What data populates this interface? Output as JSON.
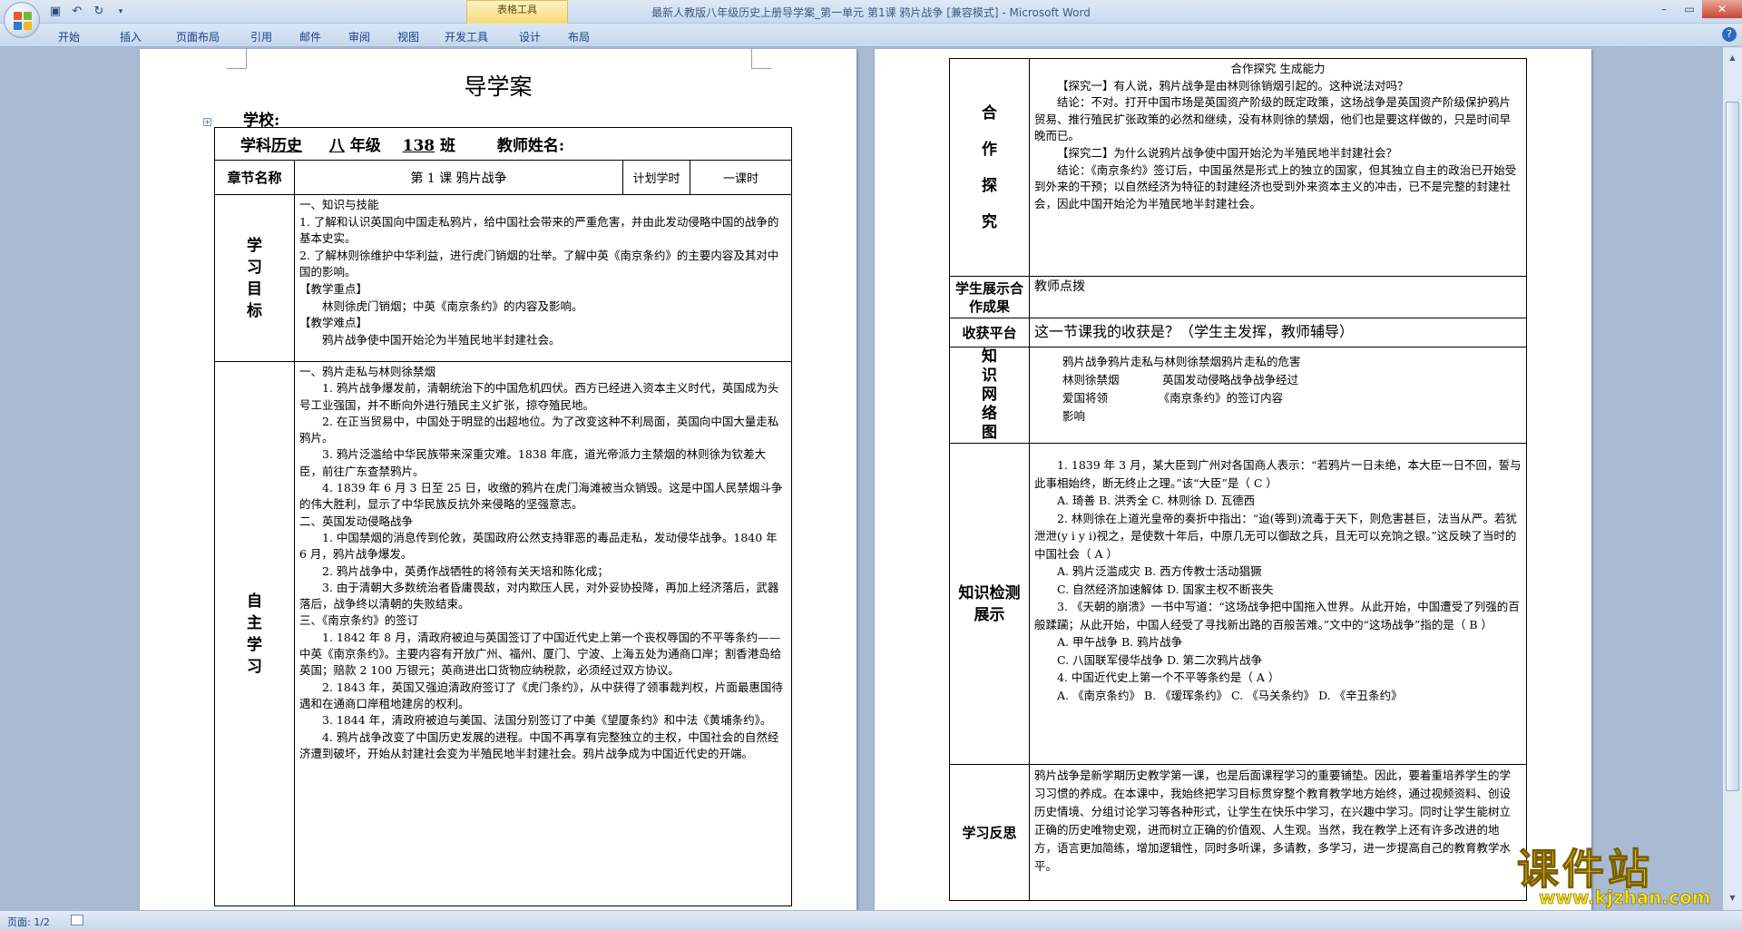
{
  "window": {
    "title": "最新人教版八年级历史上册导学案_第一单元 第1课   鸦片战争 [兼容模式] - Microsoft Word",
    "context_tab": "表格工具"
  },
  "ribbon": {
    "tabs": [
      "开始",
      "插入",
      "页面布局",
      "引用",
      "邮件",
      "审阅",
      "视图",
      "开发工具",
      "设计",
      "布局"
    ]
  },
  "status": {
    "page": "页面: 1/2"
  },
  "page1": {
    "title": "导学案",
    "school": "学校:",
    "header_row": {
      "subject_prefix": "学科",
      "subject": "历史",
      "grade": "八",
      "grade_suffix": "年级",
      "class_no": "138",
      "class_suffix": "班",
      "teacher": "教师姓名:"
    },
    "chapter": {
      "label": "章节名称",
      "title": "第 1 课   鸦片战争",
      "plan_label": "计划学时",
      "plan_value": "一课时"
    },
    "goals": {
      "label": "学习目标",
      "lines": [
        "一、知识与技能",
        "1. 了解和认识英国向中国走私鸦片，给中国社会带来的严重危害，并由此发动侵略中国的战争的基本史实。",
        "2. 了解林则徐维护中华利益，进行虎门销烟的壮举。了解中英《南京条约》的主要内容及其对中国的影响。",
        "【教学重点】",
        "林则徐虎门销烟；中英《南京条约》的内容及影响。",
        "【教学难点】",
        "鸦片战争使中国开始沦为半殖民地半封建社会。"
      ]
    },
    "self_study": {
      "label": "自主学习",
      "lines": [
        "一、鸦片走私与林则徐禁烟",
        "1. 鸦片战争爆发前，清朝统治下的中国危机四伏。西方已经进入资本主义时代，英国成为头号工业强国，并不断向外进行殖民主义扩张，掠夺殖民地。",
        "2. 在正当贸易中，中国处于明显的出超地位。为了改变这种不利局面，英国向中国大量走私鸦片。",
        "3. 鸦片泛滥给中华民族带来深重灾难。1838 年底，道光帝派力主禁烟的林则徐为钦差大臣，前往广东查禁鸦片。",
        "4. 1839 年 6 月 3 日至 25 日，收缴的鸦片在虎门海滩被当众销毁。这是中国人民禁烟斗争的伟大胜利，显示了中华民族反抗外来侵略的坚强意志。",
        "二、英国发动侵略战争",
        "1. 中国禁烟的消息传到伦敦，英国政府公然支持罪恶的毒品走私，发动侵华战争。1840 年 6 月，鸦片战争爆发。",
        "2. 鸦片战争中，英勇作战牺牲的将领有关天培和陈化成；",
        "3. 由于清朝大多数统治者昏庸畏敌，对内欺压人民，对外妥协投降，再加上经济落后，武器落后，战争终以清朝的失败结束。",
        "三、《南京条约》的签订",
        "1. 1842 年 8 月，清政府被迫与英国签订了中国近代史上第一个丧权辱国的不平等条约——中英《南京条约》。主要内容有开放广州、福州、厦门、宁波、上海五处为通商口岸；割香港岛给英国；赔款 2   100 万银元；英商进出口货物应纳税款，必须经过双方协议。",
        "2. 1843 年，英国又强迫清政府签订了《虎门条约》，从中获得了领事裁判权，片面最惠国待遇和在通商口岸租地建房的权利。",
        "3. 1844 年，清政府被迫与美国、法国分别签订了中美《望厦条约》和中法《黄埔条约》。",
        "4. 鸦片战争改变了中国历史发展的进程。中国不再享有完整独立的主权，中国社会的自然经济遭到破坏，开始从封建社会变为半殖民地半封建社会。鸦片战争成为中国近代史的开端。"
      ]
    }
  },
  "page2": {
    "explore": {
      "label": "合作探究",
      "lines": [
        "合作探究   生成能力",
        "【探究一】有人说，鸦片战争是由林则徐销烟引起的。这种说法对吗？",
        "结论：不对。打开中国市场是英国资产阶级的既定政策，这场战争是英国资产阶级保护鸦片贸易、推行殖民扩张政策的必然和继续，没有林则徐的禁烟，他们也是要这样做的，只是时间早晚而已。",
        "【探究二】为什么说鸦片战争使中国开始沦为半殖民地半封建社会？",
        "结论：《南京条约》签订后，中国虽然是形式上的独立的国家，但其独立自主的政治已开始受到外来的干预；以自然经济为特征的封建经济也受到外来资本主义的冲击，已不是完整的封建社会，因此中国开始沦为半殖民地半封建社会。"
      ]
    },
    "show": {
      "label": "学生展示合作成果",
      "text": "教师点拨"
    },
    "harvest": {
      "label": "收获平台",
      "text": "这一节课我的收获是？（学生主发挥，教师辅导）"
    },
    "network": {
      "label": "知识网络图",
      "lines": [
        "鸦片战争鸦片走私与林则徐禁烟鸦片走私的危害",
        "林则徐禁烟            英国发动侵略战争战争经过",
        "爱国将领              《南京条约》的签订内容",
        "影响"
      ]
    },
    "test": {
      "label": "知识检测展示",
      "lines": [
        "1. 1839 年 3 月，某大臣到广州对各国商人表示：“若鸦片一日未绝，本大臣一日不回，誓与此事相始终，断无终止之理。”该“大臣”是（  C  ）",
        "A. 琦善   B. 洪秀全   C. 林则徐   D. 瓦德西",
        "2. 林则徐在上道光皇帝的奏折中指出：“迨(等到)流毒于天下，则危害甚巨，法当从严。若犹泄泄(y i y i)视之，是使数十年后，中原几无可以御敌之兵，且无可以充饷之银。”这反映了当时的中国社会（  A  ）",
        "A. 鸦片泛滥成灾   B. 西方传教士活动猖獗",
        "C. 自然经济加速解体   D. 国家主权不断丧失",
        "3. 《天朝的崩溃》一书中写道：“这场战争把中国拖入世界。从此开始，中国遭受了列强的百般蹂躏；从此开始，中国人经受了寻找新出路的百般苦难。”文中的“这场战争”指的是（  B  ）",
        "A. 甲午战争   B. 鸦片战争",
        "C. 八国联军侵华战争   D. 第二次鸦片战争",
        "4. 中国近代史上第一个不平等条约是（  A  ）",
        "A. 《南京条约》   B. 《瑷珲条约》   C. 《马关条约》   D. 《辛丑条约》"
      ]
    },
    "reflect": {
      "label": "学习反思",
      "text": "鸦片战争是新学期历史教学第一课，也是后面课程学习的重要铺垫。因此，要着重培养学生的学习习惯的养成。在本课中，我始终把学习目标贯穿整个教育教学地方始终，通过视频资料、创设历史情境、分组讨论学习等各种形式，让学生在快乐中学习，在兴趣中学习。同时让学生能树立正确的历史唯物史观，进而树立正确的价值观、人生观。当然，我在教学上还有许多改进的地方，语言更加简练，增加逻辑性，同时多听课，多请教，多学习，进一步提高自己的教育教学水平。"
    }
  },
  "watermark": {
    "big": "课件站",
    "url": "www.kjzhan.com"
  },
  "colors": {
    "ribbon_text": "#15428b",
    "page_bg": "#a8bbd3",
    "watermark": "#f6e31a"
  }
}
